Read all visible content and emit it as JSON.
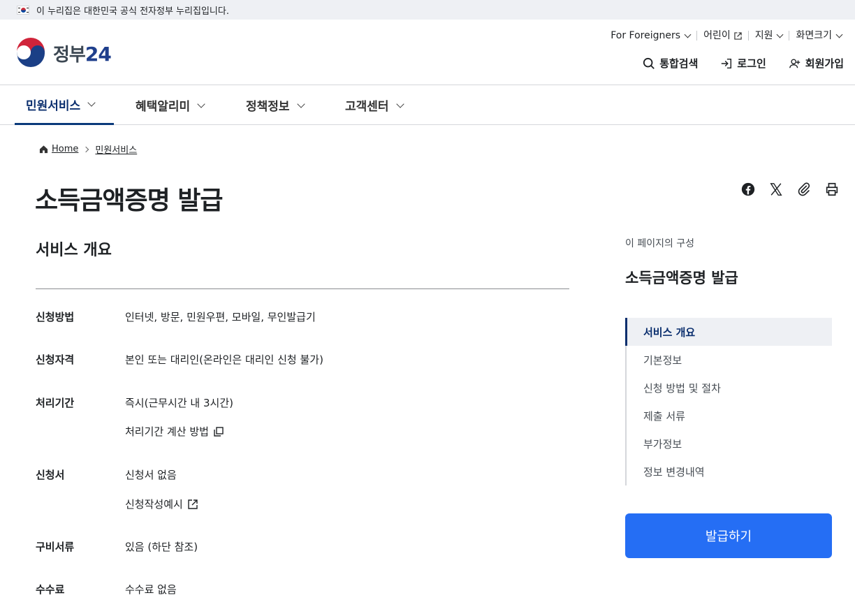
{
  "banner": {
    "text": "이 누리집은 대한민국 공식 전자정부 누리집입니다."
  },
  "logo": {
    "text": "정부",
    "num": "24"
  },
  "util_menu": [
    {
      "label": "For Foreigners",
      "type": "dropdown"
    },
    {
      "label": "어린이",
      "type": "external"
    },
    {
      "label": "지원",
      "type": "dropdown"
    },
    {
      "label": "화면크기",
      "type": "dropdown"
    }
  ],
  "actions": {
    "search": "통합검색",
    "login": "로그인",
    "signup": "회원가입"
  },
  "nav": [
    {
      "label": "민원서비스",
      "active": true
    },
    {
      "label": "혜택알리미",
      "active": false
    },
    {
      "label": "정책정보",
      "active": false
    },
    {
      "label": "고객센터",
      "active": false
    }
  ],
  "breadcrumb": {
    "home": "Home",
    "current": "민원서비스"
  },
  "page": {
    "title": "소득금액증명 발급"
  },
  "overview": {
    "title": "서비스 개요",
    "rows": [
      {
        "label": "신청방법",
        "value": "인터넷, 방문, 민원우편, 모바일, 무인발급기"
      },
      {
        "label": "신청자격",
        "value": "본인 또는 대리인(온라인은 대리인 신청 불가)"
      },
      {
        "label": "처리기간",
        "value": "즉시(근무시간 내 3시간)",
        "link": "처리기간 계산 방법"
      },
      {
        "label": "신청서",
        "value": "신청서 없음",
        "link": "신청작성예시"
      },
      {
        "label": "구비서류",
        "value": "있음 (하단 참조)"
      },
      {
        "label": "수수료",
        "value": "수수료 없음"
      }
    ]
  },
  "toc": {
    "caption": "이 페이지의 구성",
    "title": "소득금액증명 발급",
    "items": [
      "서비스 개요",
      "기본정보",
      "신청 방법 및 절차",
      "제출 서류",
      "부가정보",
      "정보 변경내역"
    ]
  },
  "cta": {
    "label": "발급하기"
  },
  "colors": {
    "primary": "#256ef4",
    "nav_active": "#0b2f6e",
    "banner_bg": "#eef0f4"
  }
}
